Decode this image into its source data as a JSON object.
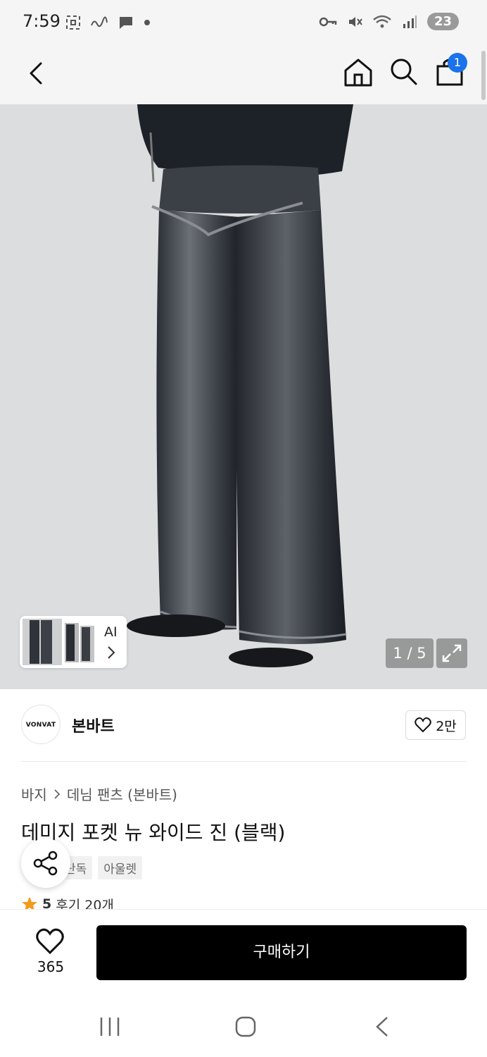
{
  "status_bar": {
    "time": "7:59",
    "battery": "23",
    "icons_left": [
      "screenshot-icon",
      "app-icon",
      "chat-icon",
      "dot-icon"
    ],
    "icons_right": [
      "key-icon",
      "mute-icon",
      "wifi-icon",
      "signal-icon",
      "battery-icon"
    ]
  },
  "header": {
    "cart_count": "1",
    "icons": [
      "back-icon",
      "home-icon",
      "search-icon",
      "cart-icon"
    ]
  },
  "gallery": {
    "ai_label": "AI",
    "page_indicator": "1 / 5",
    "current_page": 1,
    "total_pages": 5
  },
  "brand": {
    "logo_text": "VONVAT",
    "name": "본바트",
    "like_count": "2만"
  },
  "product": {
    "breadcrumb": [
      "바지",
      "데님 팬츠 (본바트)"
    ],
    "title": "데미지 포켓 뉴 와이드 진 (블랙)",
    "tags": [
      "단독",
      "아울렛"
    ],
    "rating": "5",
    "reviews": "후기 20개"
  },
  "bottom": {
    "wish_count": "365",
    "buy_label": "구매하기"
  },
  "colors": {
    "accent_badge": "#1a73e8",
    "buy_button": "#000000",
    "star": "#f29a1a",
    "image_background": "#dcdddf"
  }
}
